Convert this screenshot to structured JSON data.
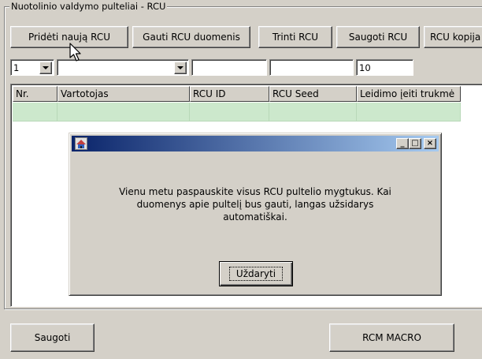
{
  "group": {
    "title": "Nuotolinio valdymo pulteliai - RCU"
  },
  "toolbar": {
    "add_label": "Pridėti naują RCU",
    "get_label": "Gauti RCU duomenis",
    "delete_label": "Trinti RCU",
    "save_label": "Saugoti RCU",
    "copy_label": "RCU kopija"
  },
  "fields": {
    "number_value": "1",
    "user_value": "",
    "rcu_id_value": "",
    "rcu_seed_value": "",
    "duration_value": "10"
  },
  "table": {
    "columns": [
      "Nr.",
      "Vartotojas",
      "RCU ID",
      "RCU Seed",
      "Leidimo įeiti trukmė"
    ]
  },
  "dialog": {
    "message_line1": "Vienu metu paspauskite visus RCU pultelio mygtukus. Kai",
    "message_line2": "duomenys apie pultelį bus gauti, langas užsidarys",
    "message_line3": "automatiškai.",
    "close_label": "Uždaryti",
    "minimize_glyph": "_",
    "maximize_glyph": "□",
    "close_glyph": "×"
  },
  "footer": {
    "save_label": "Saugoti",
    "macro_label": "RCM MACRO"
  },
  "icons": {
    "app": "app-window-icon",
    "cursor": "mouse-pointer-icon"
  },
  "colors": {
    "titlebar_start": "#0a246a",
    "titlebar_end": "#a6caf0",
    "row_highlight": "#cce8cc"
  }
}
